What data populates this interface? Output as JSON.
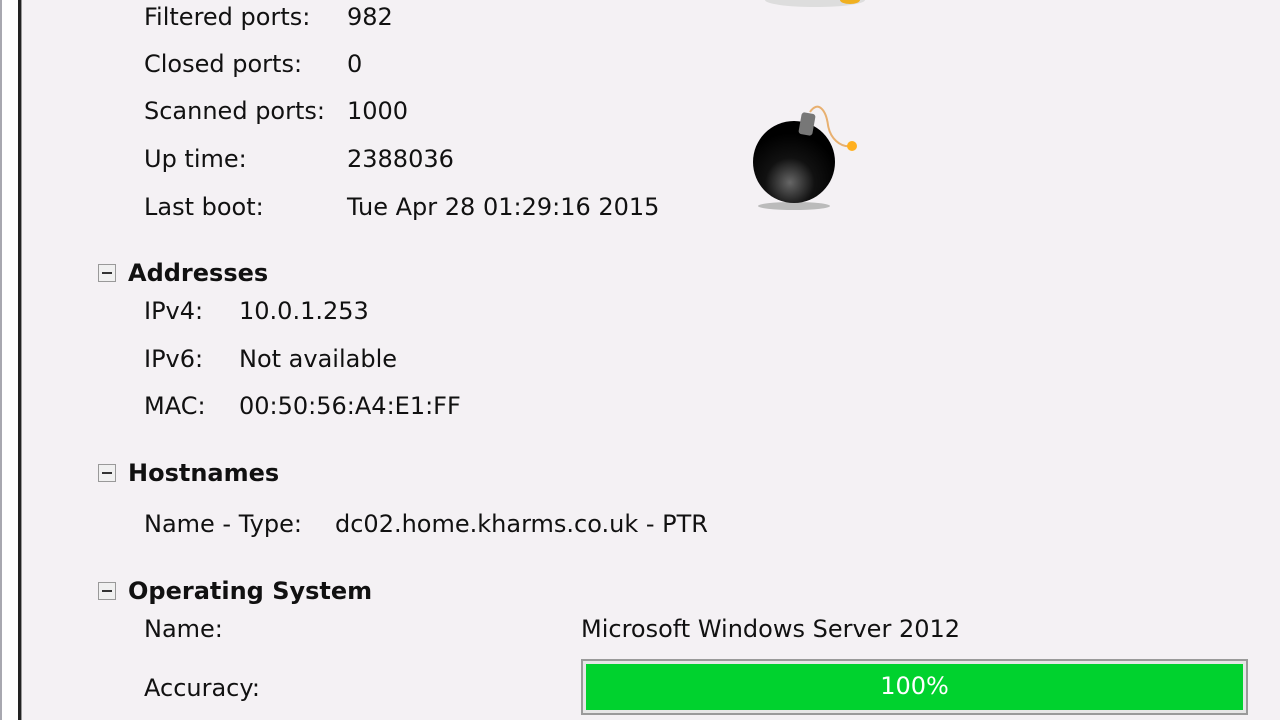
{
  "ports": {
    "filtered_label": "Filtered ports:",
    "filtered": "982",
    "closed_label": "Closed ports:",
    "closed": "0",
    "scanned_label": "Scanned ports:",
    "scanned": "1000",
    "uptime_label": "Up time:",
    "uptime": "2388036",
    "lastboot_label": "Last boot:",
    "lastboot": "Tue Apr 28 01:29:16 2015"
  },
  "addresses": {
    "title": "Addresses",
    "ipv4_label": "IPv4:",
    "ipv4": "10.0.1.253",
    "ipv6_label": "IPv6:",
    "ipv6": "Not available",
    "mac_label": "MAC:",
    "mac": "00:50:56:A4:E1:FF"
  },
  "hostnames": {
    "title": "Hostnames",
    "label": "Name - Type:",
    "value": "dc02.home.kharms.co.uk - PTR"
  },
  "os": {
    "title": "Operating System",
    "name_label": "Name:",
    "name": "Microsoft Windows Server 2012",
    "accuracy_label": "Accuracy:",
    "accuracy_text": "100%",
    "accuracy_percent": 100,
    "bar_color": "#00d22e"
  }
}
